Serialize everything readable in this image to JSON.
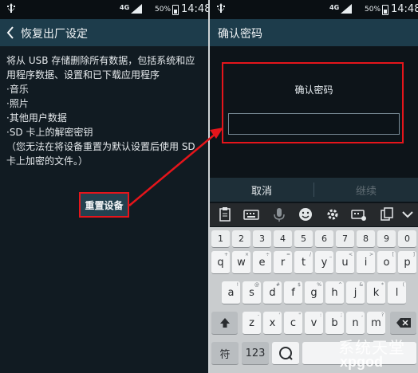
{
  "left_screen": {
    "status": {
      "network": "4G",
      "battery": "50%",
      "time": "14:48"
    },
    "title": "恢复出厂设定",
    "intro": "将从 USB 存储删除所有数据，包括系统和应用程序数据、设置和已下载应用程序",
    "items": [
      "·音乐",
      "·照片",
      "·其他用户数据",
      "·SD 卡上的解密密钥"
    ],
    "note": "（您无法在将设备重置为默认设置后使用 SD 卡上加密的文件。）",
    "reset_button": "重置设备"
  },
  "right_screen": {
    "status": {
      "network": "4G",
      "battery": "50%",
      "time": "14:48"
    },
    "title": "确认密码",
    "dialog_title": "确认密码",
    "password_value": "",
    "cancel": "取消",
    "continue": "继续",
    "keyboard": {
      "numbers": [
        "1",
        "2",
        "3",
        "4",
        "5",
        "6",
        "7",
        "8",
        "9",
        "0"
      ],
      "row1": [
        "q",
        "w",
        "e",
        "r",
        "t",
        "y",
        "u",
        "i",
        "o",
        "p"
      ],
      "row1_sub": [
        "+",
        "×",
        "÷",
        "=",
        "/",
        "_",
        "<",
        ">",
        "[",
        "]"
      ],
      "row2": [
        "a",
        "s",
        "d",
        "f",
        "g",
        "h",
        "j",
        "k",
        "l"
      ],
      "row2_sub": [
        "!",
        "@",
        "#",
        "$",
        "%",
        "^",
        "&",
        "*",
        "("
      ],
      "row3": [
        "z",
        "x",
        "c",
        "v",
        "b",
        "n",
        "m"
      ],
      "row3_sub": [
        "-",
        "'",
        "\"",
        ":",
        ";",
        ",",
        "?"
      ],
      "sym_key": "符",
      "num_key": "123"
    }
  },
  "watermark": {
    "top": "系统天堂",
    "bottom": "xpgod"
  },
  "colors": {
    "highlight": "#e5151b",
    "appbar": "#1d3c4b",
    "continue_text": "#5f6b72",
    "cancel_text": "#e6ebee"
  },
  "icons": [
    "usb-icon",
    "signal-icon",
    "battery-icon",
    "back-arrow-icon",
    "clipboard-icon",
    "keyboard-icon",
    "mic-icon",
    "emoji-icon",
    "settings-icon",
    "keyboard-settings-icon",
    "copy-icon",
    "collapse-icon",
    "shift-icon",
    "backspace-icon",
    "mic-search-icon"
  ]
}
